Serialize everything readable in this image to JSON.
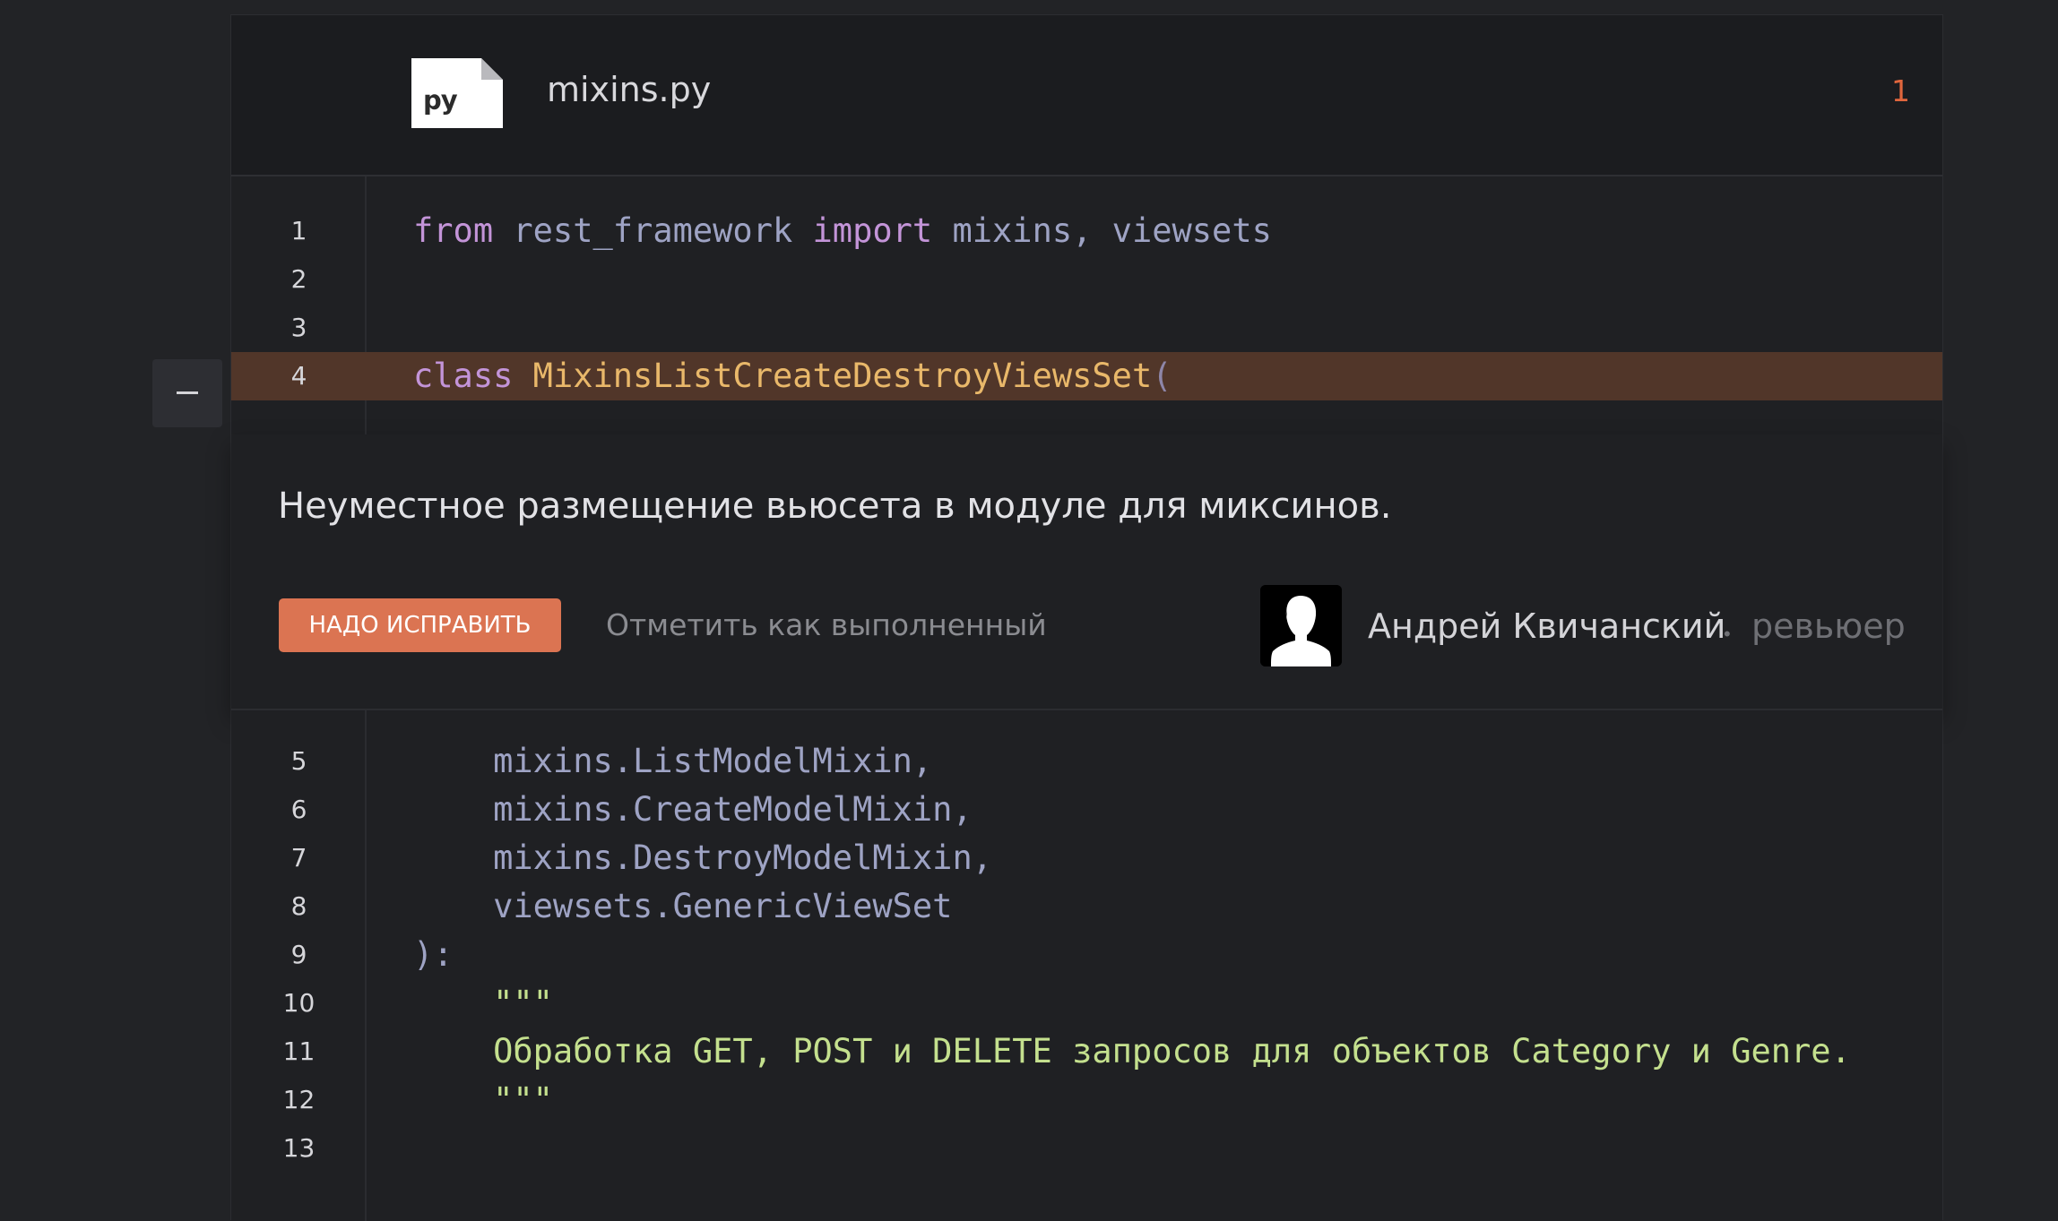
{
  "file": {
    "icon_ext": "py",
    "name": "mixins.py",
    "comment_count": "1"
  },
  "code_top": [
    {
      "n": "1",
      "tokens": [
        [
          "kw",
          "from"
        ],
        [
          "id",
          " rest_framework "
        ],
        [
          "kw",
          "import"
        ],
        [
          "id",
          " mixins, viewsets"
        ]
      ]
    },
    {
      "n": "2",
      "tokens": []
    },
    {
      "n": "3",
      "tokens": []
    },
    {
      "n": "4",
      "highlight": true,
      "tokens": [
        [
          "kw",
          "class"
        ],
        [
          "id",
          " "
        ],
        [
          "cls",
          "MixinsListCreateDestroyViewsSet"
        ],
        [
          "paren",
          "("
        ]
      ]
    }
  ],
  "comment": {
    "text": "Неуместное размещение вьюсета в модуле для миксинов.",
    "status_button": "НАДО ИСПРАВИТЬ",
    "mark_done": "Отметить как выполненный",
    "reviewer_name": "Андрей Квичанский",
    "separator": "•",
    "reviewer_role": "ревьюер"
  },
  "collapse_button": "−",
  "code_bottom": [
    {
      "n": "5",
      "tokens": [
        [
          "id",
          "    mixins.ListModelMixin,"
        ]
      ]
    },
    {
      "n": "6",
      "tokens": [
        [
          "id",
          "    mixins.CreateModelMixin,"
        ]
      ]
    },
    {
      "n": "7",
      "tokens": [
        [
          "id",
          "    mixins.DestroyModelMixin,"
        ]
      ]
    },
    {
      "n": "8",
      "tokens": [
        [
          "id",
          "    viewsets.GenericViewSet"
        ]
      ]
    },
    {
      "n": "9",
      "tokens": [
        [
          "punc",
          "):"
        ]
      ]
    },
    {
      "n": "10",
      "tokens": [
        [
          "str",
          "    \"\"\""
        ]
      ]
    },
    {
      "n": "11",
      "tokens": [
        [
          "str",
          "    Обработка GET, POST и DELETE запросов для объектов Category и Genre."
        ]
      ]
    },
    {
      "n": "12",
      "tokens": [
        [
          "str",
          "    \"\"\""
        ]
      ]
    },
    {
      "n": "13",
      "tokens": []
    }
  ],
  "colors": {
    "accent": "#db7452",
    "highlight_line": "#513629",
    "keyword": "#c394d8",
    "class_name": "#e9b86a",
    "string": "#c4e08e"
  }
}
